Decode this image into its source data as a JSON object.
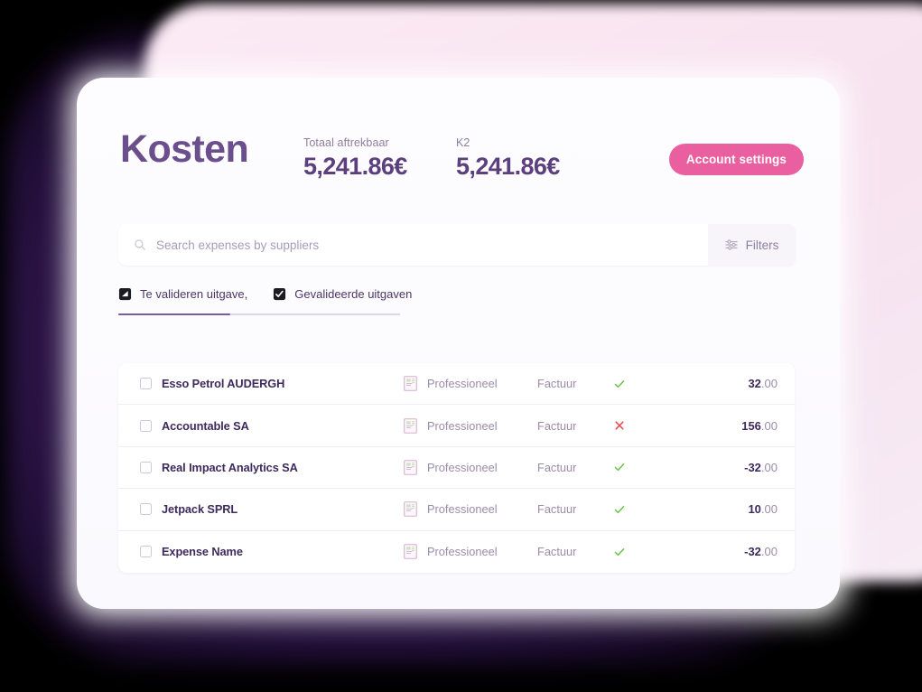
{
  "header": {
    "title": "Kosten",
    "metrics": [
      {
        "label": "Totaal aftrekbaar",
        "value": "5,241.86€"
      },
      {
        "label": "K2",
        "value": "5,241.86€"
      }
    ],
    "account_button": "Account settings",
    "accent_pink": "#ea5fa0",
    "title_purple": "#6b4e8c"
  },
  "search": {
    "placeholder": "Search expenses by suppliers",
    "value": "",
    "icon": "search-icon",
    "filters_label": "Filters",
    "filters_icon": "sliders-icon"
  },
  "tabs": [
    {
      "label": "Te valideren uitgave,",
      "icon": "pending-square-icon",
      "active": true
    },
    {
      "label": "Gevalideerde uitgaven",
      "icon": "checked-square-icon",
      "active": false
    }
  ],
  "table": {
    "rows": [
      {
        "name": "Esso Petrol AUDERGH",
        "type": "Professioneel",
        "type_icon": "receipt-icon",
        "document": "Factuur",
        "status": "approved",
        "status_icon": "check-icon",
        "amount_main": "32",
        "amount_cents": ".00",
        "checked": false
      },
      {
        "name": "Accountable SA",
        "type": "Professioneel",
        "type_icon": "receipt-icon",
        "document": "Factuur",
        "status": "rejected",
        "status_icon": "cross-icon",
        "amount_main": "156",
        "amount_cents": ".00",
        "checked": false
      },
      {
        "name": "Real Impact Analytics SA",
        "type": "Professioneel",
        "type_icon": "receipt-icon",
        "document": "Factuur",
        "status": "approved",
        "status_icon": "check-icon",
        "amount_main": "-32",
        "amount_cents": ".00",
        "checked": false
      },
      {
        "name": "Jetpack SPRL",
        "type": "Professioneel",
        "type_icon": "receipt-icon",
        "document": "Factuur",
        "status": "approved",
        "status_icon": "check-icon",
        "amount_main": "10",
        "amount_cents": ".00",
        "checked": false
      },
      {
        "name": "Expense Name",
        "type": "Professioneel",
        "type_icon": "receipt-icon",
        "document": "Factuur",
        "status": "approved",
        "status_icon": "check-icon",
        "amount_main": "-32",
        "amount_cents": ".00",
        "checked": false
      }
    ],
    "status_colors": {
      "approved": "#6ec24a",
      "rejected": "#e8484f"
    }
  }
}
